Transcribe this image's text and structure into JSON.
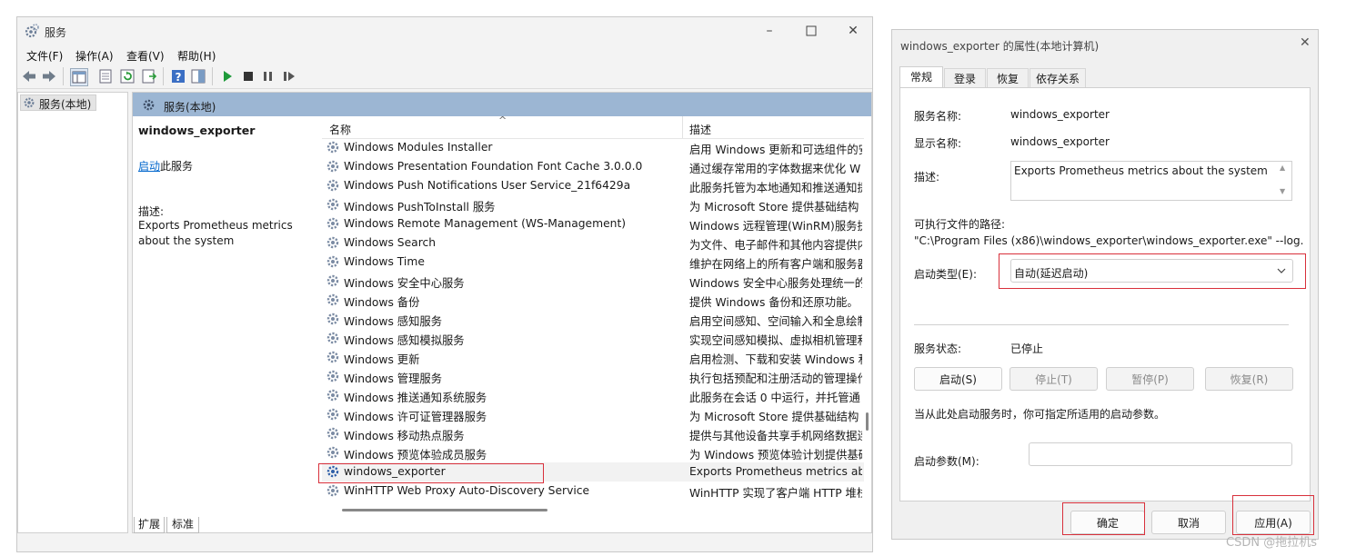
{
  "services_window": {
    "title": "服务",
    "menu": [
      "文件(F)",
      "操作(A)",
      "查看(V)",
      "帮助(H)"
    ],
    "tree_item": "服务(本地)",
    "header_title": "服务(本地)",
    "detail": {
      "service_name": "windows_exporter",
      "start_link": "启动",
      "start_suffix": "此服务",
      "desc_label": "描述:",
      "desc_line1": "Exports Prometheus metrics",
      "desc_line2": "about the system"
    },
    "columns": {
      "name": "名称",
      "description": "描述"
    },
    "rows": [
      {
        "name": "Windows Modules Installer",
        "description": "启用 Windows 更新和可选组件的安"
      },
      {
        "name": "Windows Presentation Foundation Font Cache 3.0.0.0",
        "description": "通过缓存常用的字体数据来优化 W"
      },
      {
        "name": "Windows Push Notifications User Service_21f6429a",
        "description": "此服务托管为本地通知和推送通知提"
      },
      {
        "name": "Windows PushToInstall 服务",
        "description": "为 Microsoft Store 提供基础结构"
      },
      {
        "name": "Windows Remote Management (WS-Management)",
        "description": "Windows 远程管理(WinRM)服务执"
      },
      {
        "name": "Windows Search",
        "description": "为文件、电子邮件和其他内容提供内"
      },
      {
        "name": "Windows Time",
        "description": "维护在网络上的所有客户端和服务器"
      },
      {
        "name": "Windows 安全中心服务",
        "description": "Windows 安全中心服务处理统一的"
      },
      {
        "name": "Windows 备份",
        "description": "提供 Windows 备份和还原功能。"
      },
      {
        "name": "Windows 感知服务",
        "description": "启用空间感知、空间输入和全息绘制"
      },
      {
        "name": "Windows 感知模拟服务",
        "description": "实现空间感知模拟、虚拟相机管理和"
      },
      {
        "name": "Windows 更新",
        "description": "启用检测、下载和安装 Windows 和"
      },
      {
        "name": "Windows 管理服务",
        "description": "执行包括预配和注册活动的管理操作"
      },
      {
        "name": "Windows 推送通知系统服务",
        "description": "此服务在会话 0 中运行，并托管通"
      },
      {
        "name": "Windows 许可证管理器服务",
        "description": "为 Microsoft Store 提供基础结构"
      },
      {
        "name": "Windows 移动热点服务",
        "description": "提供与其他设备共享手机网络数据连"
      },
      {
        "name": "Windows 预览体验成员服务",
        "description": "为 Windows 预览体验计划提供基础"
      },
      {
        "name": "windows_exporter",
        "description": "Exports Prometheus metrics ab"
      },
      {
        "name": "WinHTTP Web Proxy Auto-Discovery Service",
        "description": "WinHTTP 实现了客户端 HTTP 堆栈"
      }
    ],
    "bottom_tabs": [
      "扩展",
      "标准"
    ]
  },
  "dialog": {
    "title": "windows_exporter 的属性(本地计算机)",
    "tabs": [
      "常规",
      "登录",
      "恢复",
      "依存关系"
    ],
    "service_name_label": "服务名称:",
    "service_name_value": "windows_exporter",
    "display_name_label": "显示名称:",
    "display_name_value": "windows_exporter",
    "desc_label": "描述:",
    "desc_value": "Exports Prometheus metrics about the system",
    "path_label": "可执行文件的路径:",
    "path_value": "\"C:\\Program Files (x86)\\windows_exporter\\windows_exporter.exe\" --log.",
    "startup_type_label": "启动类型(E):",
    "startup_type_value": "自动(延迟启动)",
    "status_label": "服务状态:",
    "status_value": "已停止",
    "buttons": {
      "start": "启动(S)",
      "stop": "停止(T)",
      "pause": "暂停(P)",
      "resume": "恢复(R)"
    },
    "hint": "当从此处启动服务时，你可指定所适用的启动参数。",
    "params_label": "启动参数(M):",
    "params_value": "",
    "footer": {
      "ok": "确定",
      "cancel": "取消",
      "apply": "应用(A)"
    }
  },
  "watermark": "CSDN @拖拉机s",
  "colors": {
    "header_blue": "#9cb6d3",
    "highlight_red": "#d8303b",
    "link_blue": "#0066cc"
  }
}
